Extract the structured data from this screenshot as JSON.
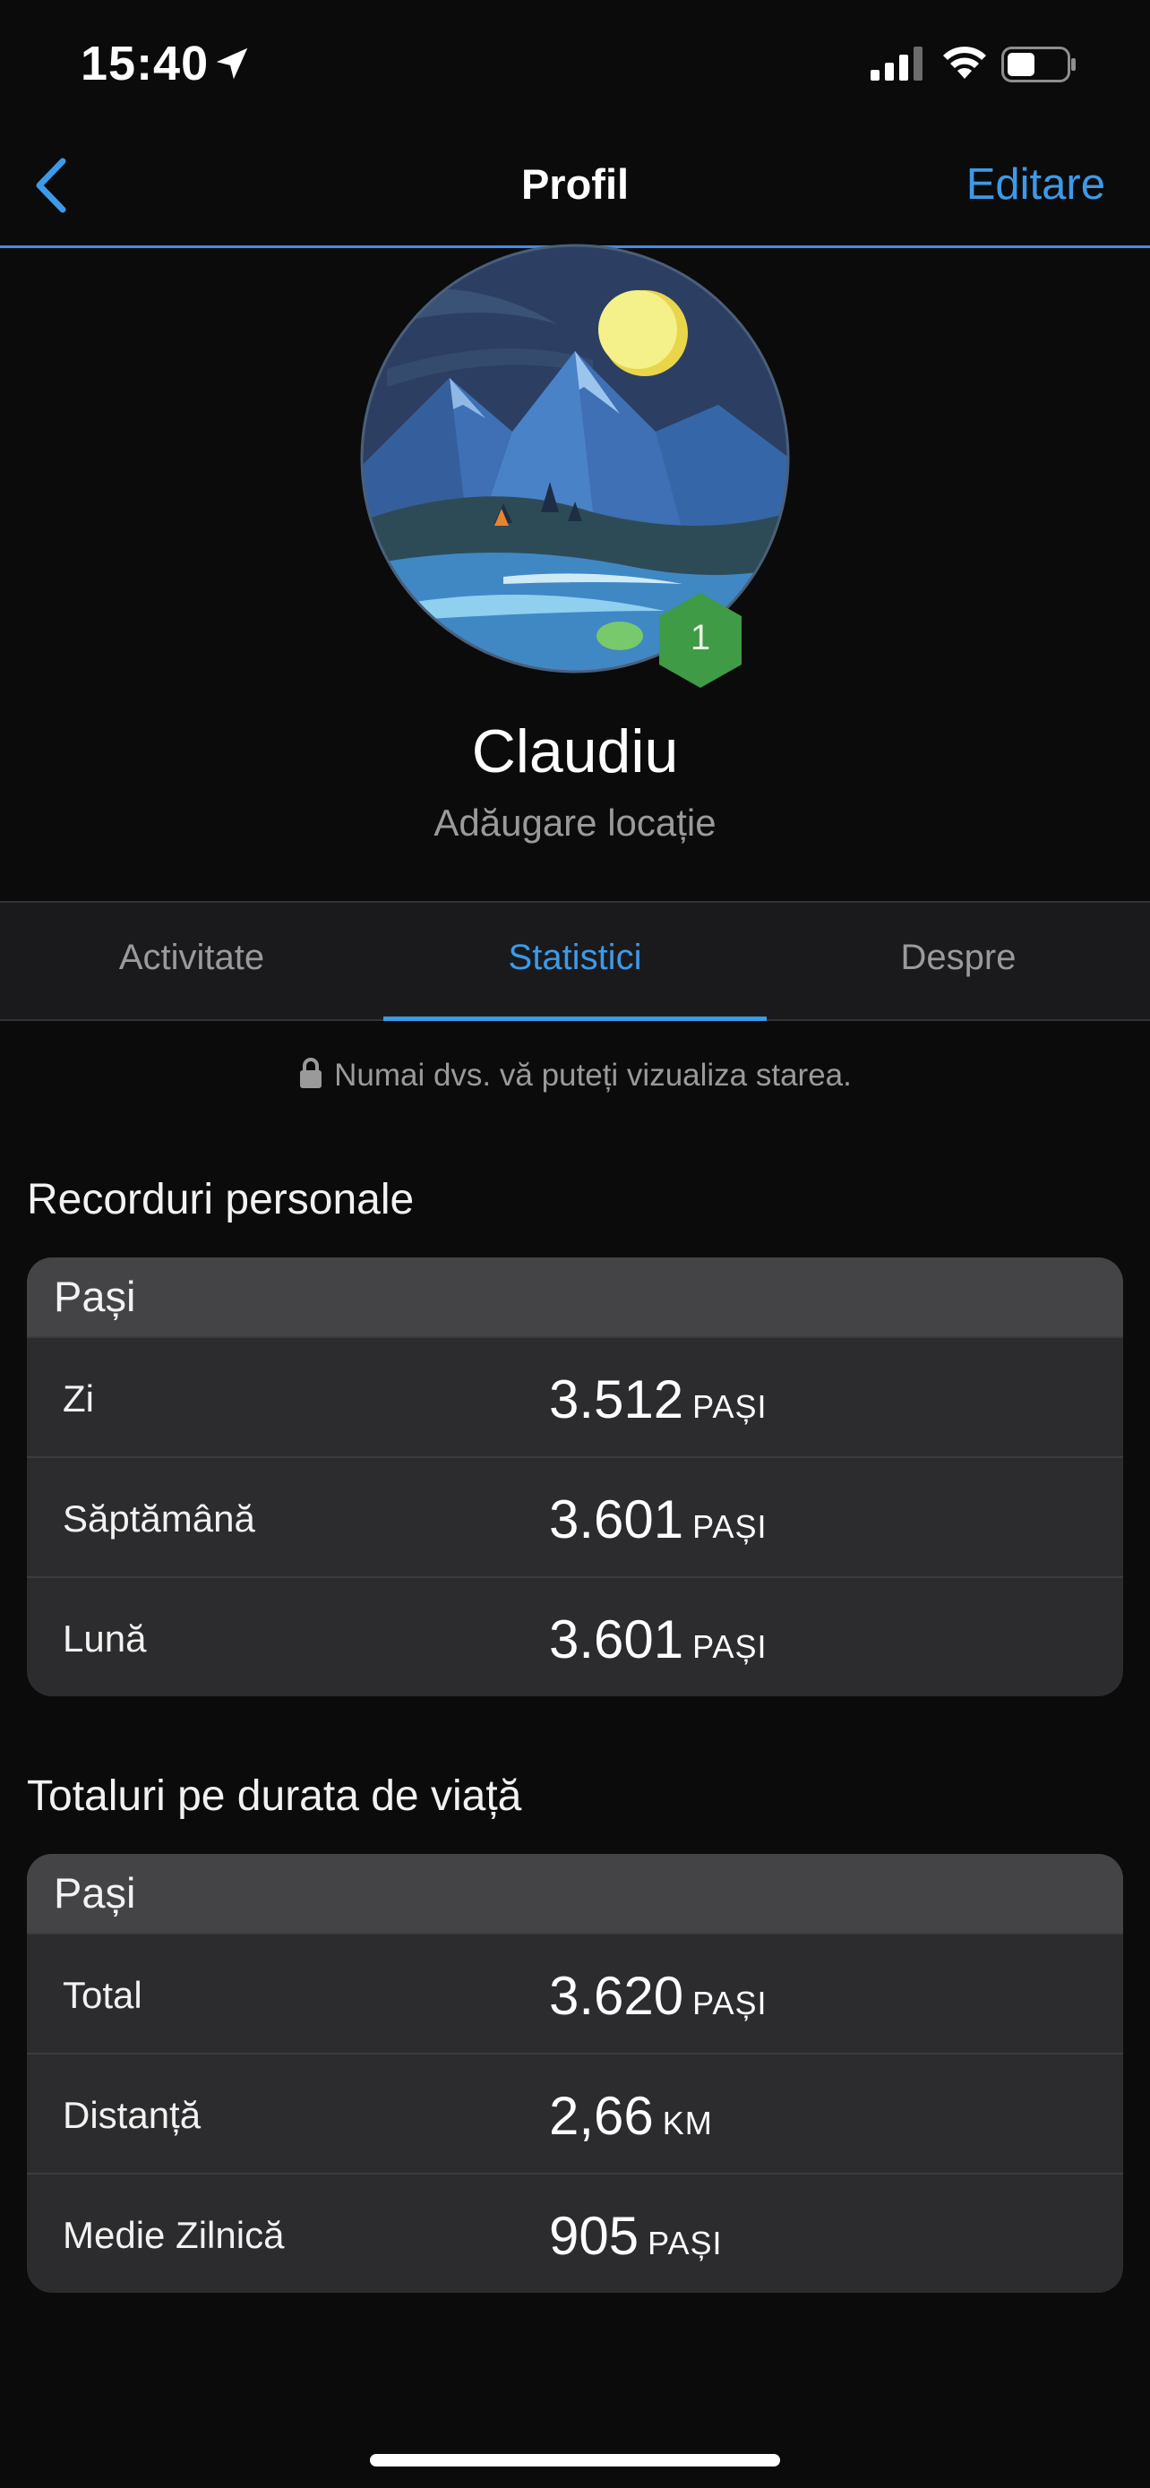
{
  "status_bar": {
    "time": "15:40"
  },
  "nav": {
    "title": "Profil",
    "edit_label": "Editare"
  },
  "profile": {
    "name": "Claudiu",
    "add_location": "Adăugare locație",
    "level": "1"
  },
  "tabs": [
    {
      "label": "Activitate"
    },
    {
      "label": "Statistici"
    },
    {
      "label": "Despre"
    }
  ],
  "privacy_note": "Numai dvs. vă puteți vizualiza starea.",
  "personal_records": {
    "title": "Recorduri personale",
    "card_title": "Pași",
    "rows": [
      {
        "label": "Zi",
        "value": "3.512",
        "unit": "PAȘI"
      },
      {
        "label": "Săptămână",
        "value": "3.601",
        "unit": "PAȘI"
      },
      {
        "label": "Lună",
        "value": "3.601",
        "unit": "PAȘI"
      }
    ]
  },
  "lifetime_totals": {
    "title": "Totaluri pe durata de viață",
    "card_title": "Pași",
    "rows": [
      {
        "label": "Total",
        "value": "3.620",
        "unit": "PAȘI"
      },
      {
        "label": "Distanță",
        "value": "2,66",
        "unit": "KM"
      },
      {
        "label": "Medie Zilnică",
        "value": "905",
        "unit": "PAȘI"
      }
    ]
  },
  "colors": {
    "accent": "#3d9ae8",
    "background": "#0b0b0c",
    "card": "#2c2c2e",
    "badge": "#3f9b45"
  }
}
